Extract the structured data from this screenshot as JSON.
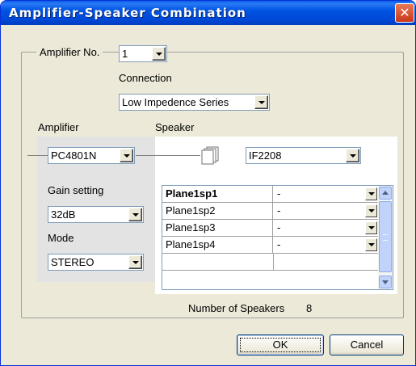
{
  "window": {
    "title": "Amplifier-Speaker Combination",
    "close_glyph": "✕"
  },
  "amplifier_no": {
    "label": "Amplifier No.",
    "value": "1"
  },
  "connection": {
    "label": "Connection",
    "value": "Low Impedence Series"
  },
  "amplifier": {
    "label": "Amplifier",
    "model": "PC4801N",
    "gain_label": "Gain setting",
    "gain_value": "32dB",
    "mode_label": "Mode",
    "mode_value": "STEREO"
  },
  "speaker": {
    "label": "Speaker",
    "model": "IF2208"
  },
  "speaker_table": {
    "rows": [
      {
        "name": "Plane1sp1",
        "assign": "-",
        "selected": true
      },
      {
        "name": "Plane1sp2",
        "assign": "-",
        "selected": false
      },
      {
        "name": "Plane1sp3",
        "assign": "-",
        "selected": false
      },
      {
        "name": "Plane1sp4",
        "assign": "-",
        "selected": false
      }
    ]
  },
  "number_of_speakers": {
    "label": "Number of Speakers",
    "value": "8"
  },
  "buttons": {
    "ok": "OK",
    "cancel": "Cancel"
  },
  "colors": {
    "title_bar": "#0054e3",
    "dialog_bg": "#ece9d8",
    "close_button": "#d6502d"
  }
}
